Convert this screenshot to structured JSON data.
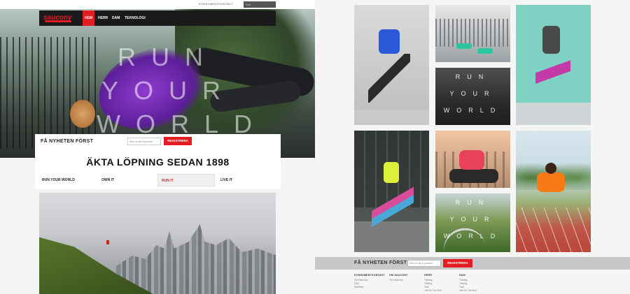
{
  "utility": {
    "contact_link": "KONSUMENTKONTAKT",
    "search_placeholder": "Sök"
  },
  "nav": {
    "logo": "saucony",
    "items": [
      {
        "label": "HEM",
        "active": true
      },
      {
        "label": "HERR",
        "active": false
      },
      {
        "label": "DAM",
        "active": false
      },
      {
        "label": "TEKNOLOGI",
        "active": false
      }
    ]
  },
  "hero": {
    "words": [
      "RUN",
      "YOUR",
      "WORLD"
    ]
  },
  "newsletter": {
    "label": "FÅ NYHETEN FÖRST",
    "placeholder": "Skriv in din e-postadr.",
    "button": "REGISTRERA"
  },
  "tagline": "ÄKTA LÖPNING SEDAN 1898",
  "tabs": [
    {
      "label": "RUN YOUR WORLD",
      "active": false
    },
    {
      "label": "OWN IT",
      "active": false
    },
    {
      "label": "RUN IT",
      "active": true
    },
    {
      "label": "LIVE IT",
      "active": false
    }
  ],
  "tiles": {
    "t4_words": [
      "RUN",
      "YOUR",
      "WORLD"
    ],
    "t7_words": [
      "RUN",
      "YOUR",
      "WORLD"
    ]
  },
  "footer": {
    "columns": [
      {
        "head": "KONSUMENTKONTAKT",
        "items": [
          "Om Saucony",
          "FAQ",
          "Storlekar"
        ]
      },
      {
        "head": "OM SAUCONY",
        "items": [
          "Om Saucony"
        ]
      },
      {
        "head": "HERR",
        "items": [
          "Träning",
          "Tävling",
          "Trail",
          "Life On The Run"
        ]
      },
      {
        "head": "DAM",
        "items": [
          "Träning",
          "Tävling",
          "Trail",
          "Life On The Run"
        ]
      }
    ]
  },
  "colors": {
    "brand_red": "#e41c23",
    "nav_bg": "#1a1a1a"
  }
}
